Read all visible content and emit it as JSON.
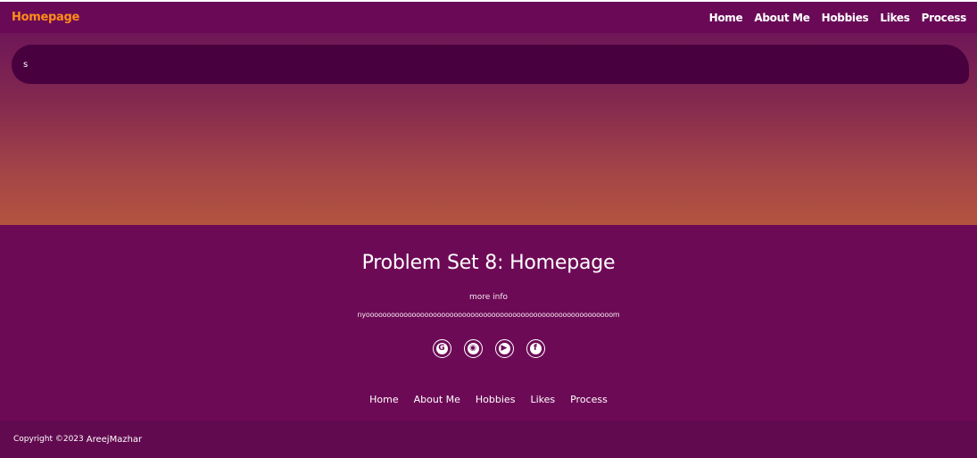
{
  "navbar": {
    "brand": "Homepage",
    "links": [
      "Home",
      "About Me",
      "Hobbies",
      "Likes",
      "Process"
    ]
  },
  "hero": {
    "pill_text": "s"
  },
  "footer": {
    "title": "Problem Set 8: Homepage",
    "more_info": "more info",
    "nyo_text": "nyooooooooooooooooooooooooooooooooooooooooooooooooooooooooooom",
    "socials": [
      {
        "icon": "google-icon",
        "glyph": "G"
      },
      {
        "icon": "discord-icon",
        "glyph": "◉"
      },
      {
        "icon": "youtube-icon",
        "glyph": "▶"
      },
      {
        "icon": "facebook-icon",
        "glyph": "f"
      }
    ],
    "links": [
      "Home",
      "About Me",
      "Hobbies",
      "Likes",
      "Process"
    ]
  },
  "copyright": {
    "prefix": "Copyright ©2023",
    "author": "AreejMazhar"
  },
  "colors": {
    "brand": "#ff8c1a",
    "purple": "#6d0a56",
    "pill": "#48003f"
  }
}
